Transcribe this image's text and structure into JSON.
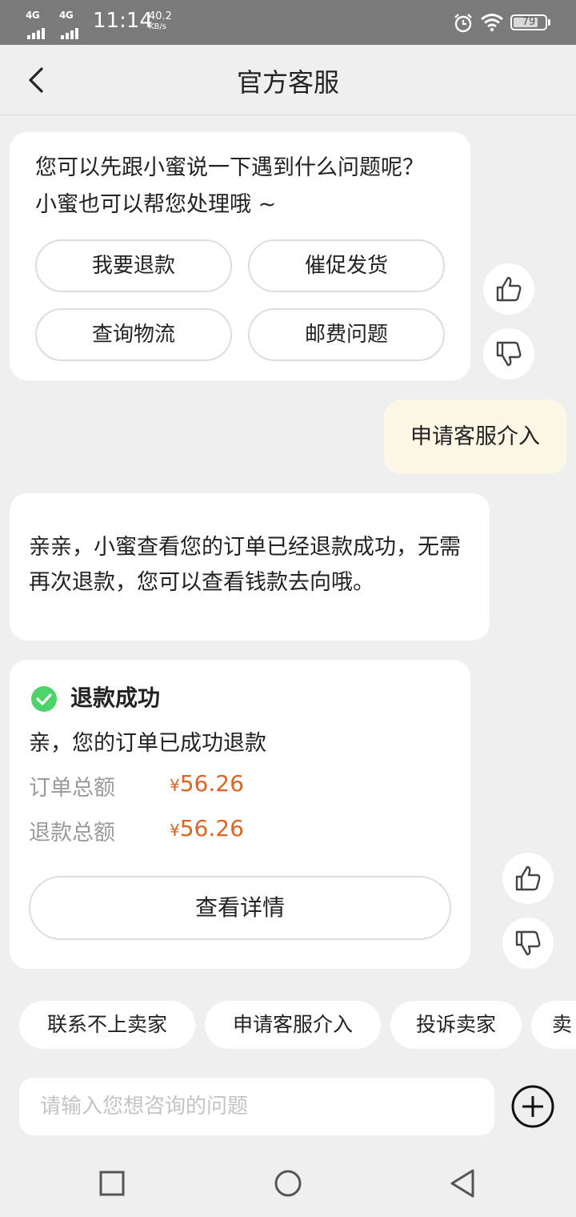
{
  "status_bar": {
    "network_1": "4G",
    "network_2": "4G",
    "time": "11:14",
    "speed_value": "40.2",
    "speed_unit": "KB/s",
    "battery": "79"
  },
  "header": {
    "title": "官方客服"
  },
  "bot_message_1": {
    "text": "您可以先跟小蜜说一下遇到什么问题呢？ 小蜜也可以帮您处理哦 ~",
    "quick_replies": [
      "我要退款",
      "催促发货",
      "查询物流",
      "邮费问题"
    ]
  },
  "user_message": {
    "text": "申请客服介入"
  },
  "bot_message_2": {
    "text": "亲亲，小蜜查看您的订单已经退款成功，无需再次退款，您可以查看钱款去向哦。"
  },
  "refund_card": {
    "title": "退款成功",
    "description": "亲，您的订单已成功退款",
    "order_total_label": "订单总额",
    "order_total_currency": "¥",
    "order_total_value": "56.26",
    "refund_total_label": "退款总额",
    "refund_total_currency": "¥",
    "refund_total_value": "56.26",
    "detail_button": "查看详情"
  },
  "shortcuts": [
    "联系不上卖家",
    "申请客服介入",
    "投诉卖家",
    "卖"
  ],
  "input": {
    "placeholder": "请输入您想咨询的问题"
  },
  "colors": {
    "accent_orange": "#e0641e",
    "success_green": "#4cd46a",
    "user_bubble": "#fdf7e6"
  }
}
